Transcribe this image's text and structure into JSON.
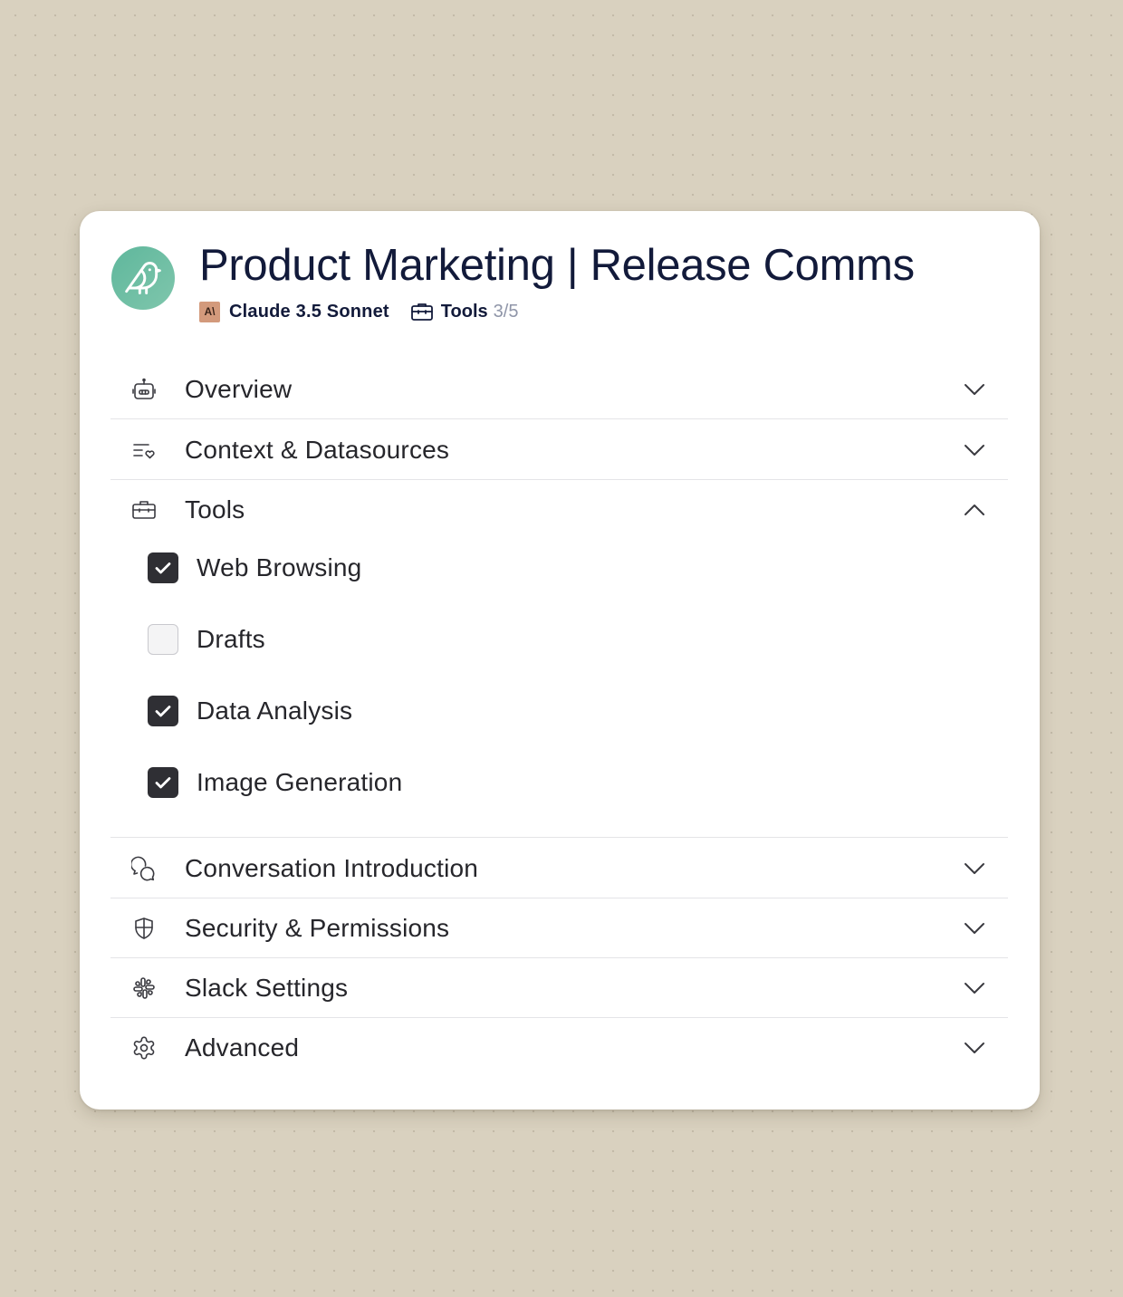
{
  "header": {
    "title": "Product Marketing | Release Comms",
    "model_badge": "A\\",
    "model_name": "Claude 3.5 Sonnet",
    "tools_label": "Tools",
    "tools_count": "3/5"
  },
  "sections": {
    "overview": {
      "label": "Overview",
      "icon": "robot-icon",
      "expanded": false
    },
    "context": {
      "label": "Context & Datasources",
      "icon": "list-heart-icon",
      "expanded": false
    },
    "tools": {
      "label": "Tools",
      "icon": "briefcase-icon",
      "expanded": true,
      "items": [
        {
          "label": "Web Browsing",
          "checked": true
        },
        {
          "label": "Drafts",
          "checked": false
        },
        {
          "label": "Data Analysis",
          "checked": true
        },
        {
          "label": "Image Generation",
          "checked": true
        }
      ]
    },
    "conversation": {
      "label": "Conversation Introduction",
      "icon": "chat-bubbles-icon",
      "expanded": false
    },
    "security": {
      "label": "Security & Permissions",
      "icon": "shield-icon",
      "expanded": false
    },
    "slack": {
      "label": "Slack Settings",
      "icon": "slack-icon",
      "expanded": false
    },
    "advanced": {
      "label": "Advanced",
      "icon": "gear-icon",
      "expanded": false
    }
  },
  "colors": {
    "background": "#d9d1bf",
    "avatar": "#6bbda3",
    "title": "#121a3a",
    "checkbox_checked": "#2f2f34",
    "model_badge": "#d39a7c"
  }
}
